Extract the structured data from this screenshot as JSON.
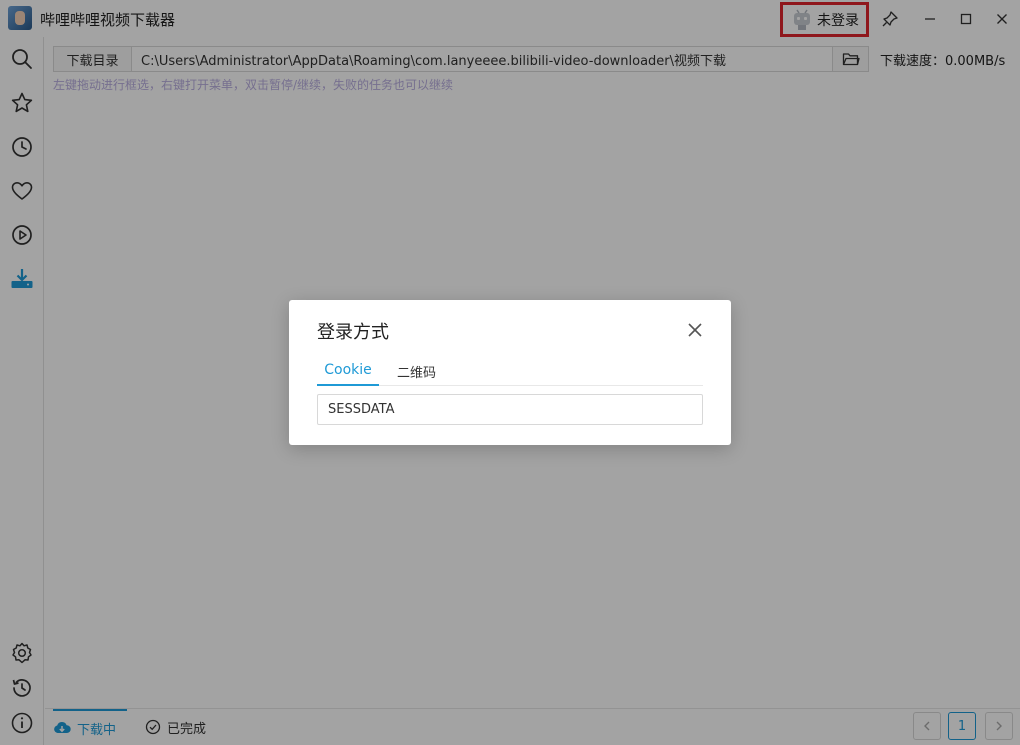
{
  "window": {
    "title": "哔哩哔哩视频下载器",
    "login_status": "未登录"
  },
  "toolbar": {
    "dir_label": "下载目录",
    "dir_path": "C:\\Users\\Administrator\\AppData\\Roaming\\com.lanyeeee.bilibili-video-downloader\\视频下载",
    "speed": "下载速度：0.00MB/s",
    "hint": "左键拖动进行框选，右键打开菜单，双击暂停/继续，失败的任务也可以继续"
  },
  "bottom": {
    "tab_downloading": "下载中",
    "tab_completed": "已完成",
    "page_current": "1"
  },
  "dialog": {
    "title": "登录方式",
    "tabs": [
      "Cookie",
      "二维码"
    ],
    "input_placeholder": "SESSDATA"
  },
  "colors": {
    "accent": "#1f9ad6",
    "highlight_border": "#e0242c",
    "hint_text": "#b9aee0"
  },
  "icons": {
    "sidebar_top": [
      "search-icon",
      "star-icon",
      "clock-icon",
      "heart-icon",
      "play-icon",
      "download-icon"
    ],
    "sidebar_bottom": [
      "gear-icon",
      "history-icon",
      "info-icon"
    ]
  }
}
